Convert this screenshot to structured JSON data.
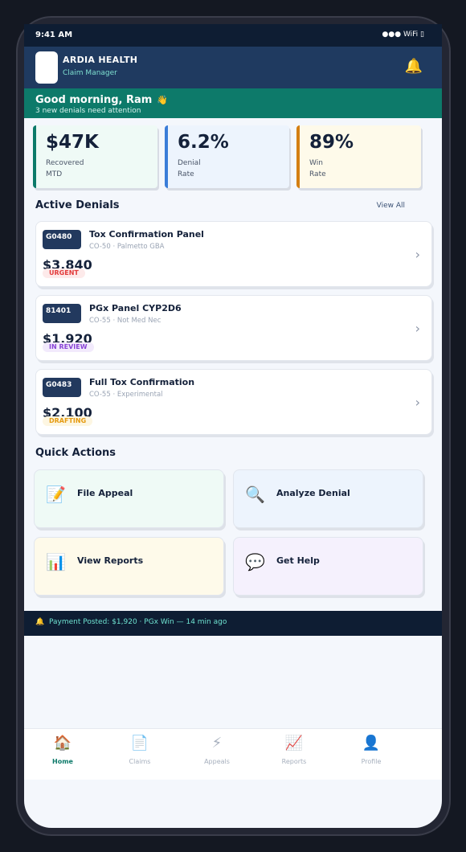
{
  "status_bar": {
    "time": "9:41 AM",
    "indicators": "●●● WiFi ▯"
  },
  "header": {
    "brand": "ARDIA HEALTH",
    "subtitle": "Claim Manager",
    "bell_icon": "🔔"
  },
  "greeting": {
    "title": "Good morning, Ram",
    "wave_icon": "👋",
    "subtitle": "3 new denials need attention"
  },
  "stats": [
    {
      "value": "$47K",
      "label": "Recovered\nMTD",
      "accent": "#0d7a6a",
      "bg": "#effaf6"
    },
    {
      "value": "6.2%",
      "label": "Denial\nRate",
      "accent": "#3b7dd8",
      "bg": "#edf4fd"
    },
    {
      "value": "89%",
      "label": "Win\nRate",
      "accent": "#d47f12",
      "bg": "#fefaea"
    }
  ],
  "active_denials": {
    "title": "Active Denials",
    "view_all": "View All",
    "items": [
      {
        "code": "G0480",
        "title": "Tox Confirmation Panel",
        "subtitle": "CO-50 · Palmetto GBA",
        "amount": "$3,840",
        "status": "URGENT",
        "status_color": "#e23b3b",
        "status_bg": "#fdeaea"
      },
      {
        "code": "81401",
        "title": "PGx Panel CYP2D6",
        "subtitle": "CO-55 · Not Med Nec",
        "amount": "$1,920",
        "status": "IN REVIEW",
        "status_color": "#8a45d6",
        "status_bg": "#f2eafc"
      },
      {
        "code": "G0483",
        "title": "Full Tox Confirmation",
        "subtitle": "CO-55 · Experimental",
        "amount": "$2,100",
        "status": "DRAFTING",
        "status_color": "#e59a10",
        "status_bg": "#fdf6e2"
      }
    ]
  },
  "quick_actions": {
    "title": "Quick Actions",
    "items": [
      {
        "label": "File Appeal",
        "icon": "📝",
        "icon_color": "#0d7a6a",
        "bg": "#effaf6"
      },
      {
        "label": "Analyze Denial",
        "icon": "🔍",
        "icon_color": "#22395e",
        "bg": "#edf4fd"
      },
      {
        "label": "View Reports",
        "icon": "📊",
        "icon_color": "#e59a10",
        "bg": "#fefaea"
      },
      {
        "label": "Get Help",
        "icon": "💬",
        "icon_color": "#8a45d6",
        "bg": "#f5f1fd"
      }
    ]
  },
  "ticker": {
    "icon": "🔔",
    "text": "Payment Posted: $1,920 · PGx Win  —  14 min ago"
  },
  "tabs": [
    {
      "label": "Home",
      "icon": "🏠",
      "active": true
    },
    {
      "label": "Claims",
      "icon": "📄",
      "active": false
    },
    {
      "label": "Appeals",
      "icon": "⚡",
      "active": false
    },
    {
      "label": "Reports",
      "icon": "📈",
      "active": false
    },
    {
      "label": "Profile",
      "icon": "👤",
      "active": false
    }
  ],
  "colors": {
    "primary": "#1f3a60",
    "teal": "#0d7a6a",
    "dark": "#0e1d33"
  }
}
